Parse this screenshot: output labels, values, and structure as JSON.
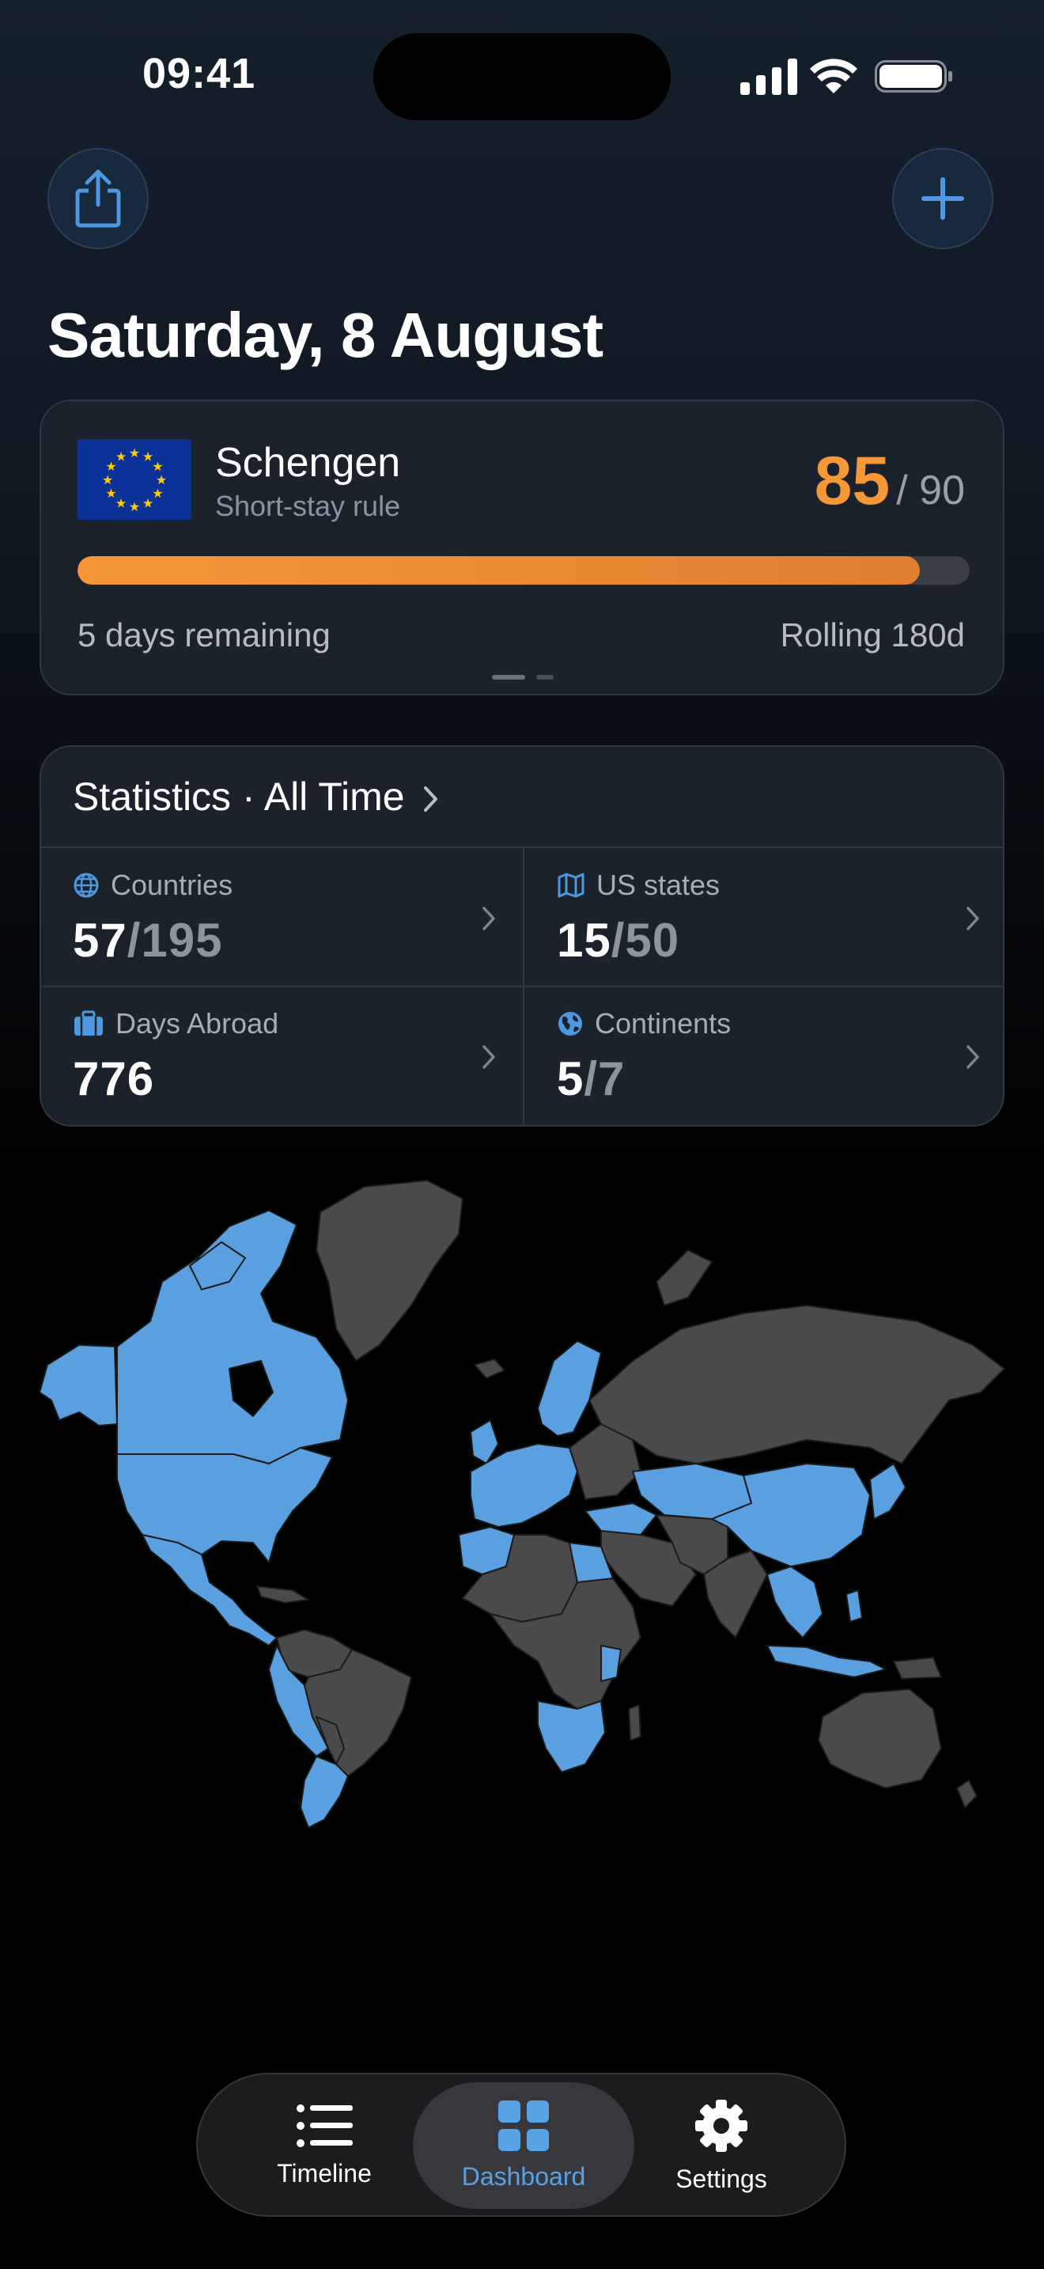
{
  "status_bar": {
    "time": "09:41"
  },
  "header": {
    "share_icon": "share-icon",
    "add_icon": "plus-icon",
    "date": "Saturday, 8 August"
  },
  "schengen": {
    "flag_icon": "eu-flag-icon",
    "title": "Schengen",
    "subtitle": "Short-stay rule",
    "days_used": "85",
    "days_limit": "/ 90",
    "progress_fraction": 0.944,
    "remaining": "5 days remaining",
    "window": "Rolling 180d",
    "page_count": 2,
    "current_page": 1,
    "accent_color": "#f59838"
  },
  "statistics": {
    "title": "Statistics · All Time",
    "cells": [
      {
        "label": "Countries",
        "icon": "globe-icon",
        "value": "57",
        "total": "/195"
      },
      {
        "label": "US states",
        "icon": "map-icon",
        "value": "15",
        "total": "/50"
      },
      {
        "label": "Days Abroad",
        "icon": "suitcase-icon",
        "value": "776",
        "total": ""
      },
      {
        "label": "Continents",
        "icon": "earth-icon",
        "value": "5",
        "total": "/7"
      }
    ]
  },
  "map": {
    "visited_color": "#5a9fe0",
    "unvisited_color": "#4a4a4c"
  },
  "tabbar": {
    "tabs": [
      {
        "label": "Timeline",
        "icon": "list-icon",
        "active": false
      },
      {
        "label": "Dashboard",
        "icon": "grid-icon",
        "active": true
      },
      {
        "label": "Settings",
        "icon": "gear-icon",
        "active": false
      }
    ]
  }
}
